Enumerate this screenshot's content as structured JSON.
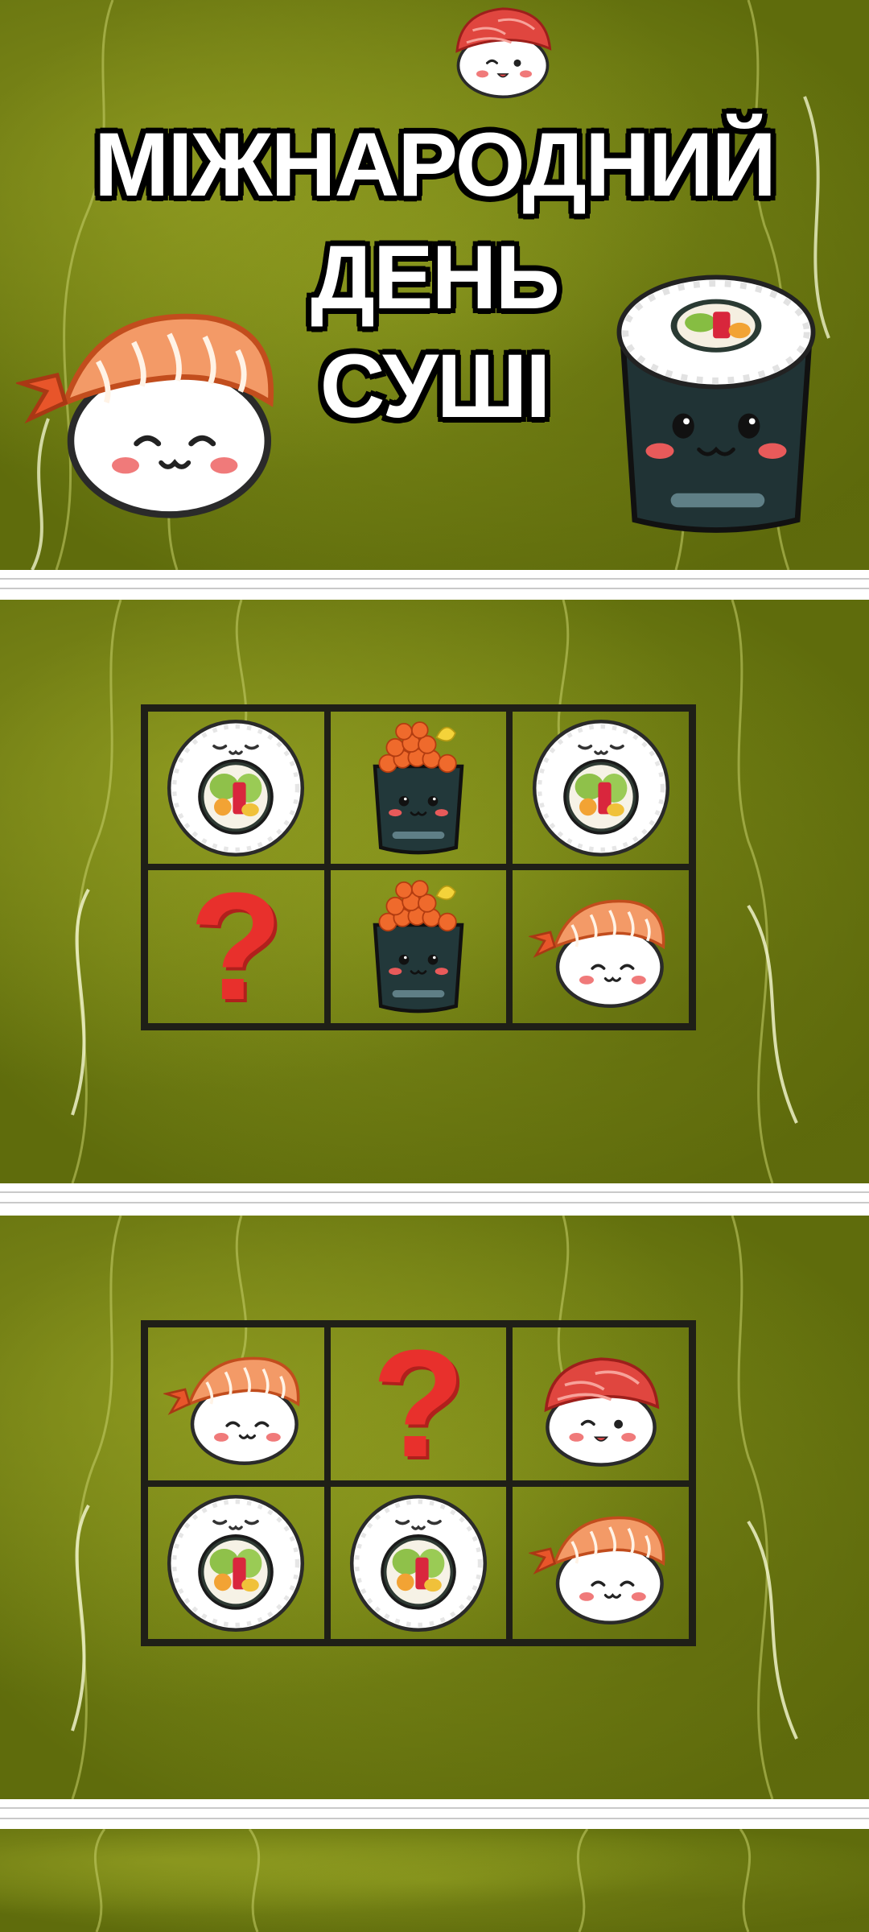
{
  "title": {
    "line1": "МІЖНАРОДНИЙ",
    "line2": "ДЕНЬ",
    "line3": "СУШІ"
  },
  "colors": {
    "background": "#7a8a16",
    "grid_line": "#1f1f17",
    "question_mark": "#e8302c"
  },
  "puzzles": [
    {
      "cells": [
        {
          "item": "maki-roll-icon",
          "text": ""
        },
        {
          "item": "ikura-gunkan-icon",
          "text": ""
        },
        {
          "item": "maki-roll-icon",
          "text": ""
        },
        {
          "item": "question-mark",
          "text": "?"
        },
        {
          "item": "ikura-gunkan-icon",
          "text": ""
        },
        {
          "item": "shrimp-nigiri-icon",
          "text": ""
        }
      ]
    },
    {
      "cells": [
        {
          "item": "shrimp-nigiri-icon",
          "text": ""
        },
        {
          "item": "question-mark",
          "text": "?"
        },
        {
          "item": "salmon-nigiri-icon",
          "text": ""
        },
        {
          "item": "maki-roll-icon",
          "text": ""
        },
        {
          "item": "maki-roll-icon",
          "text": ""
        },
        {
          "item": "shrimp-nigiri-icon",
          "text": ""
        }
      ]
    }
  ]
}
